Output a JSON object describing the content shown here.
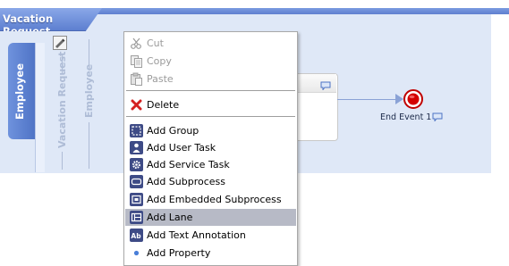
{
  "pool": {
    "title": "Vacation Request",
    "lane_tab_label": "Employee",
    "lane_labels": [
      "Vacation Request",
      "Employee"
    ]
  },
  "end_event": {
    "label": "End Event 1"
  },
  "context_menu": {
    "items": [
      {
        "label": "Cut",
        "icon": "scissors-icon",
        "enabled": false
      },
      {
        "label": "Copy",
        "icon": "copy-icon",
        "enabled": false
      },
      {
        "label": "Paste",
        "icon": "paste-icon",
        "enabled": false
      },
      {
        "label": "Delete",
        "icon": "delete-icon",
        "enabled": true
      },
      {
        "label": "Add Group",
        "icon": "group-icon",
        "enabled": true
      },
      {
        "label": "Add User Task",
        "icon": "user-task-icon",
        "enabled": true
      },
      {
        "label": "Add Service Task",
        "icon": "service-task-icon",
        "enabled": true
      },
      {
        "label": "Add Subprocess",
        "icon": "subprocess-icon",
        "enabled": true
      },
      {
        "label": "Add Embedded Subprocess",
        "icon": "embedded-subprocess-icon",
        "enabled": true
      },
      {
        "label": "Add Lane",
        "icon": "lane-icon",
        "enabled": true,
        "highlighted": true
      },
      {
        "label": "Add Text Annotation",
        "icon": "text-annotation-icon",
        "enabled": true
      },
      {
        "label": "Add Property",
        "icon": "property-icon",
        "enabled": true
      }
    ]
  },
  "colors": {
    "pool_header": "#6f8fdc",
    "canvas": "#dfe8f7",
    "menu_highlight": "#b7bac6",
    "end_event_red": "#d40000",
    "delete_red": "#d42020"
  }
}
